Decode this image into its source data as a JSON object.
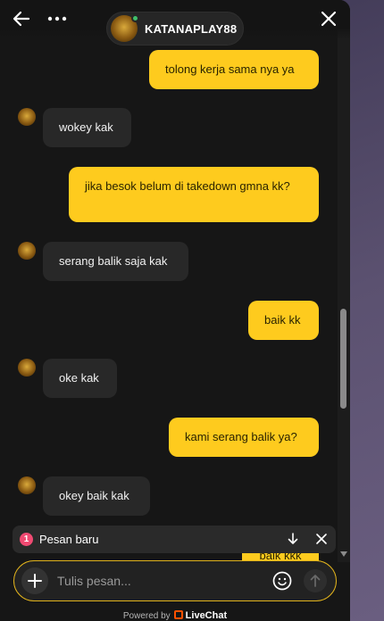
{
  "header": {
    "agent_name": "KATANAPLAY88",
    "icons": {
      "back": "arrow-left-icon",
      "more": "more-dots-icon",
      "close": "close-icon"
    },
    "status_color": "#3fbf6b"
  },
  "messages": [
    {
      "from": "visitor",
      "text": "tolong kerja sama nya ya"
    },
    {
      "from": "agent",
      "text": "wokey kak"
    },
    {
      "from": "visitor",
      "text": "jika besok belum di takedown gmna kk?"
    },
    {
      "from": "agent",
      "text": "serang balik saja kak"
    },
    {
      "from": "visitor",
      "text": "baik kk"
    },
    {
      "from": "agent",
      "text": "oke kak"
    },
    {
      "from": "visitor",
      "text": "kami serang balik ya?"
    },
    {
      "from": "agent",
      "text": "okey baik kak"
    },
    {
      "from": "visitor",
      "text": "baik kkk"
    }
  ],
  "new_message_toast": {
    "count": "1",
    "label": "Pesan baru"
  },
  "composer": {
    "placeholder": "Tulis pesan...",
    "value": ""
  },
  "footer": {
    "powered_by": "Powered by",
    "brand": "LiveChat"
  },
  "colors": {
    "accent": "#fecb1e",
    "badge": "#f04a72",
    "livechat_brand": "#ff5100"
  }
}
